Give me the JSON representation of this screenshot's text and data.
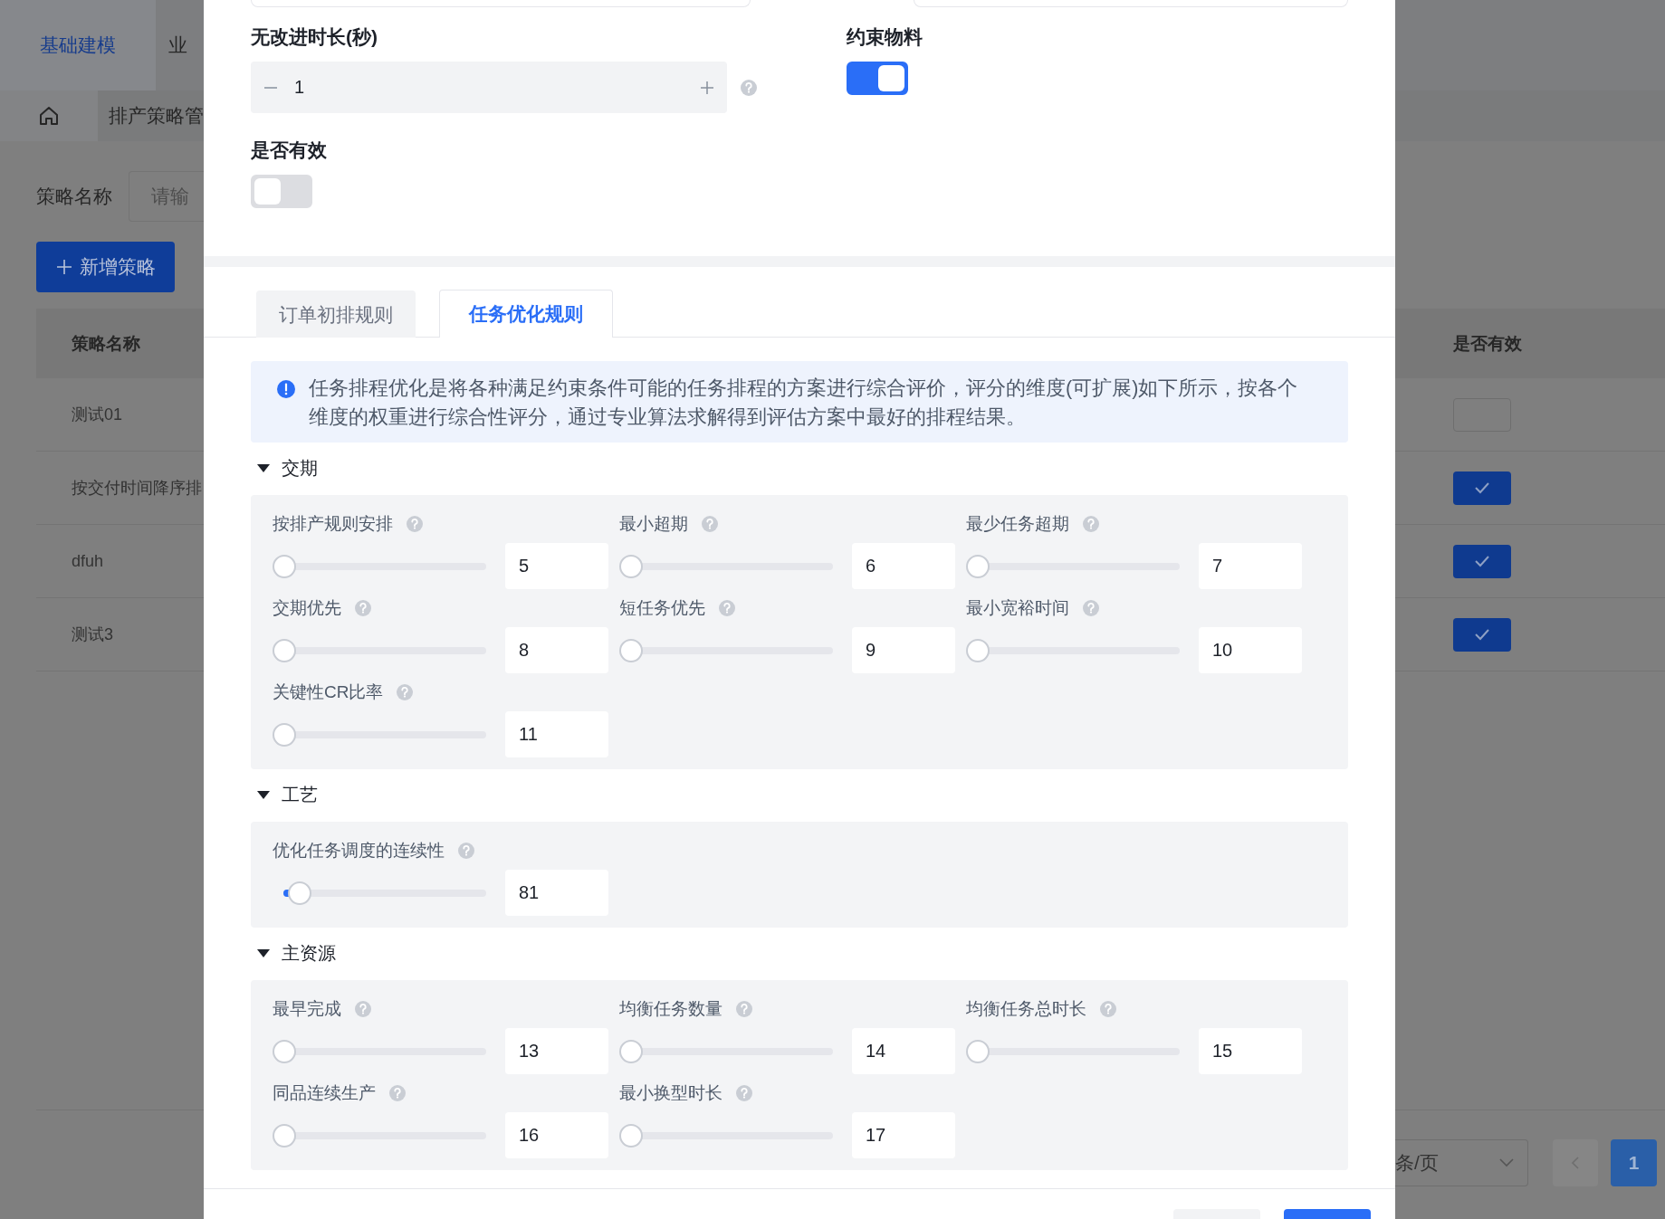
{
  "nav": {
    "tabs": [
      {
        "label": "基础建模",
        "selected": true
      },
      {
        "label": "业",
        "selected": false
      }
    ]
  },
  "breadcrumb": {
    "label": "排产策略管"
  },
  "filter": {
    "label": "策略名称",
    "placeholder": "请输"
  },
  "add_button": {
    "label": "新增策略"
  },
  "table": {
    "columns": [
      "策略名称",
      "是否有效"
    ],
    "rows": [
      {
        "name": "测试01",
        "valid": false
      },
      {
        "name": "按交付时间降序排",
        "valid": true
      },
      {
        "name": "dfuh",
        "valid": true
      },
      {
        "name": "测试3",
        "valid": true
      }
    ]
  },
  "pagination": {
    "page_size": "条/页",
    "pages": [
      {
        "label": "1",
        "selected": true
      }
    ]
  },
  "modal": {
    "fields": [
      {
        "kind": "stepper",
        "label": "无改进时长(秒)",
        "value": "1",
        "help": true
      },
      {
        "kind": "switch",
        "label": "约束物料",
        "on": true
      },
      {
        "kind": "switch",
        "label": "是否有效",
        "on": false
      }
    ],
    "tabs": [
      {
        "label": "订单初排规则",
        "selected": false
      },
      {
        "label": "任务优化规则",
        "selected": true
      }
    ],
    "alert": "任务排程优化是将各种满足约束条件可能的任务排程的方案进行综合评价，评分的维度(可扩展)如下所示，按各个维度的权重进行综合性评分，通过专业算法求解得到评估方案中最好的排程结果。",
    "sections": [
      {
        "title": "交期",
        "expanded": true,
        "items": [
          {
            "label": "按排产规则安排",
            "level": 0,
            "value": "5"
          },
          {
            "label": "最小超期",
            "level": 0,
            "value": "6"
          },
          {
            "label": "最少任务超期",
            "level": 0,
            "value": "7"
          },
          {
            "label": "交期优先",
            "level": 0,
            "value": "8"
          },
          {
            "label": "短任务优先",
            "level": 0,
            "value": "9"
          },
          {
            "label": "最小宽裕时间",
            "level": 0,
            "value": "10"
          },
          {
            "label": "关键性CR比率",
            "level": 0,
            "value": "11"
          }
        ]
      },
      {
        "title": "工艺",
        "expanded": true,
        "items": [
          {
            "label": "优化任务调度的连续性",
            "level": 0.08,
            "value": "81"
          }
        ]
      },
      {
        "title": "主资源",
        "expanded": true,
        "items": [
          {
            "label": "最早完成",
            "level": 0,
            "value": "13"
          },
          {
            "label": "均衡任务数量",
            "level": 0,
            "value": "14"
          },
          {
            "label": "均衡任务总时长",
            "level": 0,
            "value": "15"
          },
          {
            "label": "同品连续生产",
            "level": 0,
            "value": "16"
          },
          {
            "label": "最小换型时长",
            "level": 0,
            "value": "17"
          }
        ]
      }
    ]
  }
}
